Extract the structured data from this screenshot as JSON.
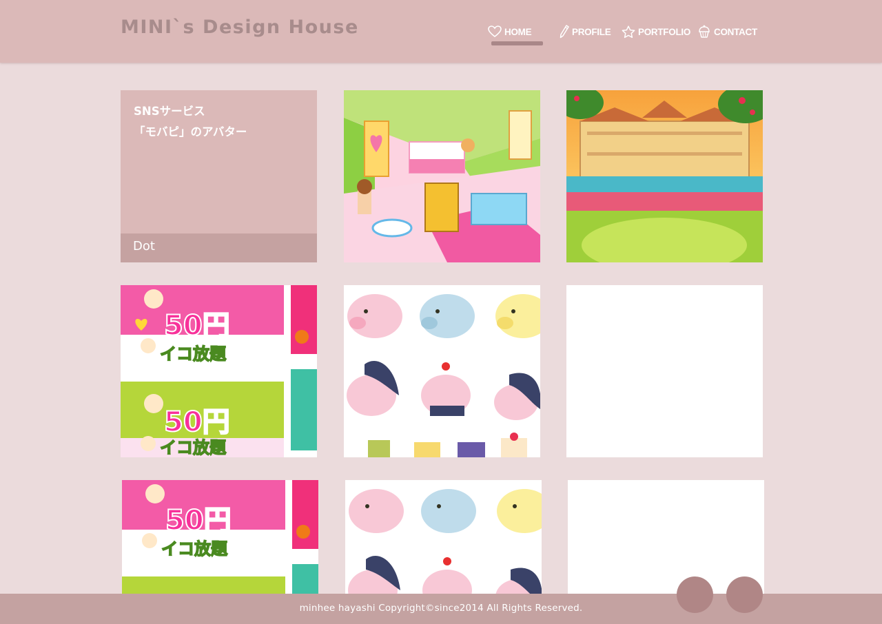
{
  "header": {
    "logo": "MINI`s Design House",
    "nav": [
      {
        "label": "HOME",
        "icon": "heart-icon",
        "active": true
      },
      {
        "label": "PROFILE",
        "icon": "pencil-icon"
      },
      {
        "label": "PORTFOLIO",
        "icon": "star-icon"
      },
      {
        "label": "CONTACT",
        "icon": "cupcake-icon"
      }
    ]
  },
  "portfolio": {
    "featured": {
      "title_line1": "SNSサービス",
      "title_line2": "「モバピ」のアバター",
      "category": "Dot"
    },
    "banner_text": {
      "price": "50円",
      "tagline": "イコ放題"
    }
  },
  "footer": {
    "copyright": "minhee hayashi Copyright©since2014 All Rights Reserved."
  },
  "colors": {
    "header": "#dbb9b8",
    "background": "#ebdbdc",
    "footer": "#c4a2a1",
    "accent": "#a98788",
    "circle_button": "#b08686"
  }
}
